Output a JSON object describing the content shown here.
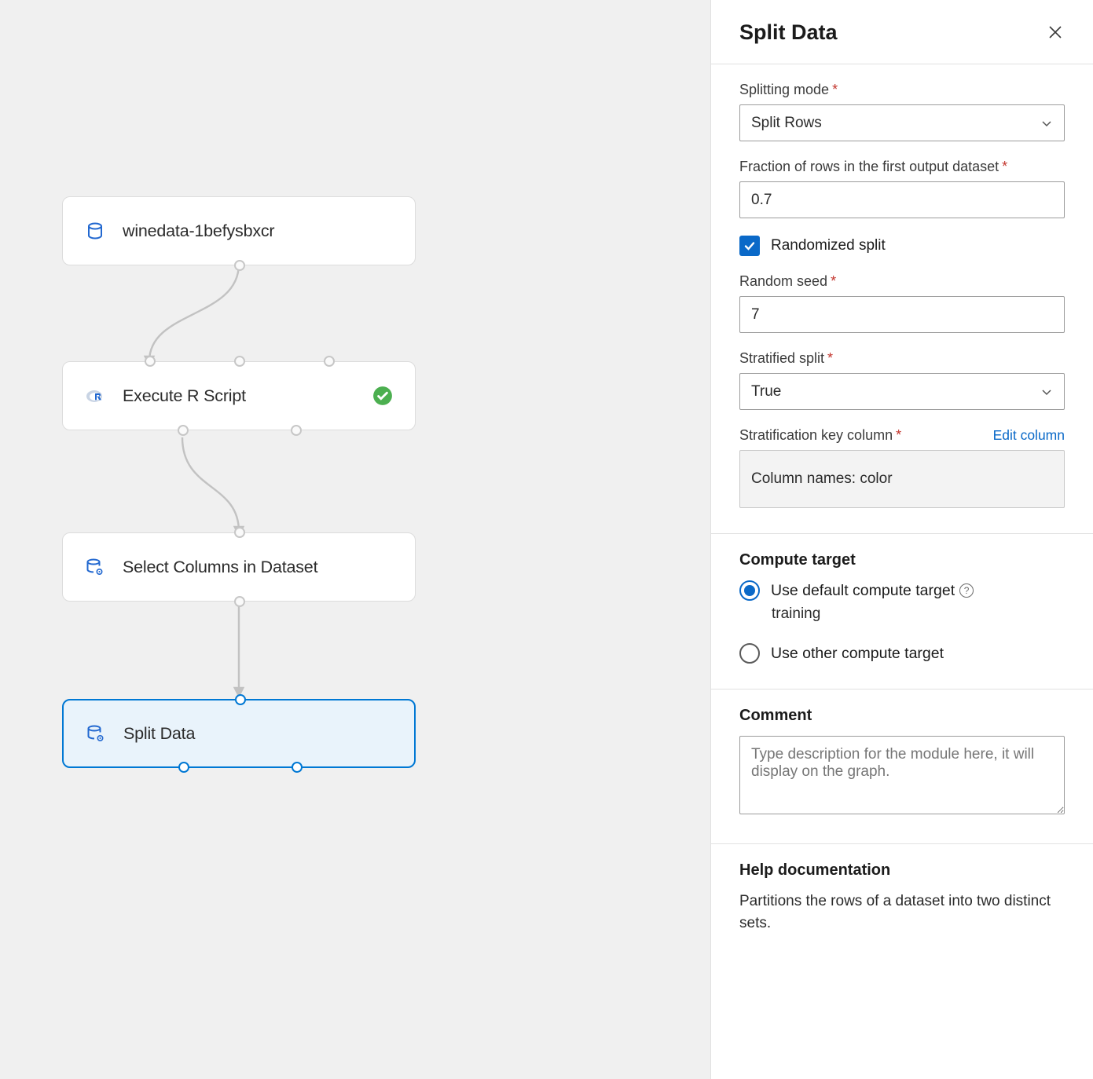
{
  "nodes": {
    "dataset": {
      "label": "winedata-1befysbxcr"
    },
    "rscript": {
      "label": "Execute R Script"
    },
    "select_cols": {
      "label": "Select Columns in Dataset"
    },
    "split": {
      "label": "Split Data"
    }
  },
  "panel": {
    "title": "Split Data",
    "splitting_mode": {
      "label": "Splitting mode",
      "value": "Split Rows"
    },
    "fraction": {
      "label": "Fraction of rows in the first output dataset",
      "value": "0.7"
    },
    "randomized": {
      "label": "Randomized split",
      "checked": true
    },
    "seed": {
      "label": "Random seed",
      "value": "7"
    },
    "stratified": {
      "label": "Stratified split",
      "value": "True"
    },
    "strat_key": {
      "label": "Stratification key column",
      "edit_link": "Edit column",
      "value": "Column names: color"
    },
    "compute": {
      "heading": "Compute target",
      "default_label": "Use default compute target",
      "default_value": "training",
      "other_label": "Use other compute target"
    },
    "comment": {
      "heading": "Comment",
      "placeholder": "Type description for the module here, it will display on the graph."
    },
    "help": {
      "heading": "Help documentation",
      "text": "Partitions the rows of a dataset into two distinct sets."
    }
  }
}
